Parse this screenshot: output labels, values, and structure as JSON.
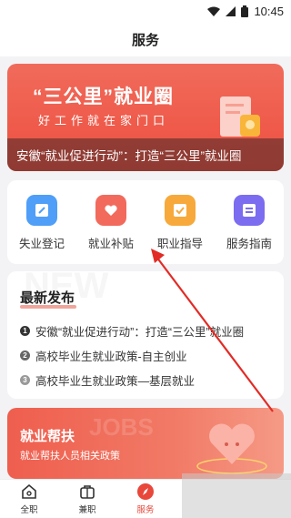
{
  "status_bar": {
    "time": "10:45"
  },
  "header": {
    "title": "服务"
  },
  "banner": {
    "title": "“三公里”就业圈",
    "subtitle": "好工作就在家门口",
    "caption": "安徽“就业促进行动”：打造“三公里”就业圈"
  },
  "services": [
    {
      "label": "失业登记",
      "icon": "pencil-note-icon",
      "color": "#4f9ef8"
    },
    {
      "label": "就业补贴",
      "icon": "heart-hand-icon",
      "color": "#f26a5c"
    },
    {
      "label": "职业指导",
      "icon": "checklist-icon",
      "color": "#f7a93b"
    },
    {
      "label": "服务指南",
      "icon": "list-doc-icon",
      "color": "#7b6cf0"
    }
  ],
  "news": {
    "ghost": "NEW",
    "title": "最新发布",
    "items": [
      {
        "num": "1",
        "text": "安徽“就业促进行动”：打造“三公里”就业圈",
        "color": "#333333"
      },
      {
        "num": "2",
        "text": "高校毕业生就业政策-自主创业",
        "color": "#666666"
      },
      {
        "num": "3",
        "text": "高校毕业生就业政策—基层就业",
        "color": "#999999"
      }
    ]
  },
  "assist": {
    "ghost": "JOBS",
    "title": "就业帮扶",
    "subtitle": "就业帮扶人员相关政策"
  },
  "nav": [
    {
      "label": "全职",
      "icon": "home-icon"
    },
    {
      "label": "兼职",
      "icon": "briefcase-icon"
    },
    {
      "label": "服务",
      "icon": "compass-icon",
      "active": true
    }
  ],
  "colors": {
    "accent": "#e8473a",
    "background": "#f3f3f5"
  }
}
